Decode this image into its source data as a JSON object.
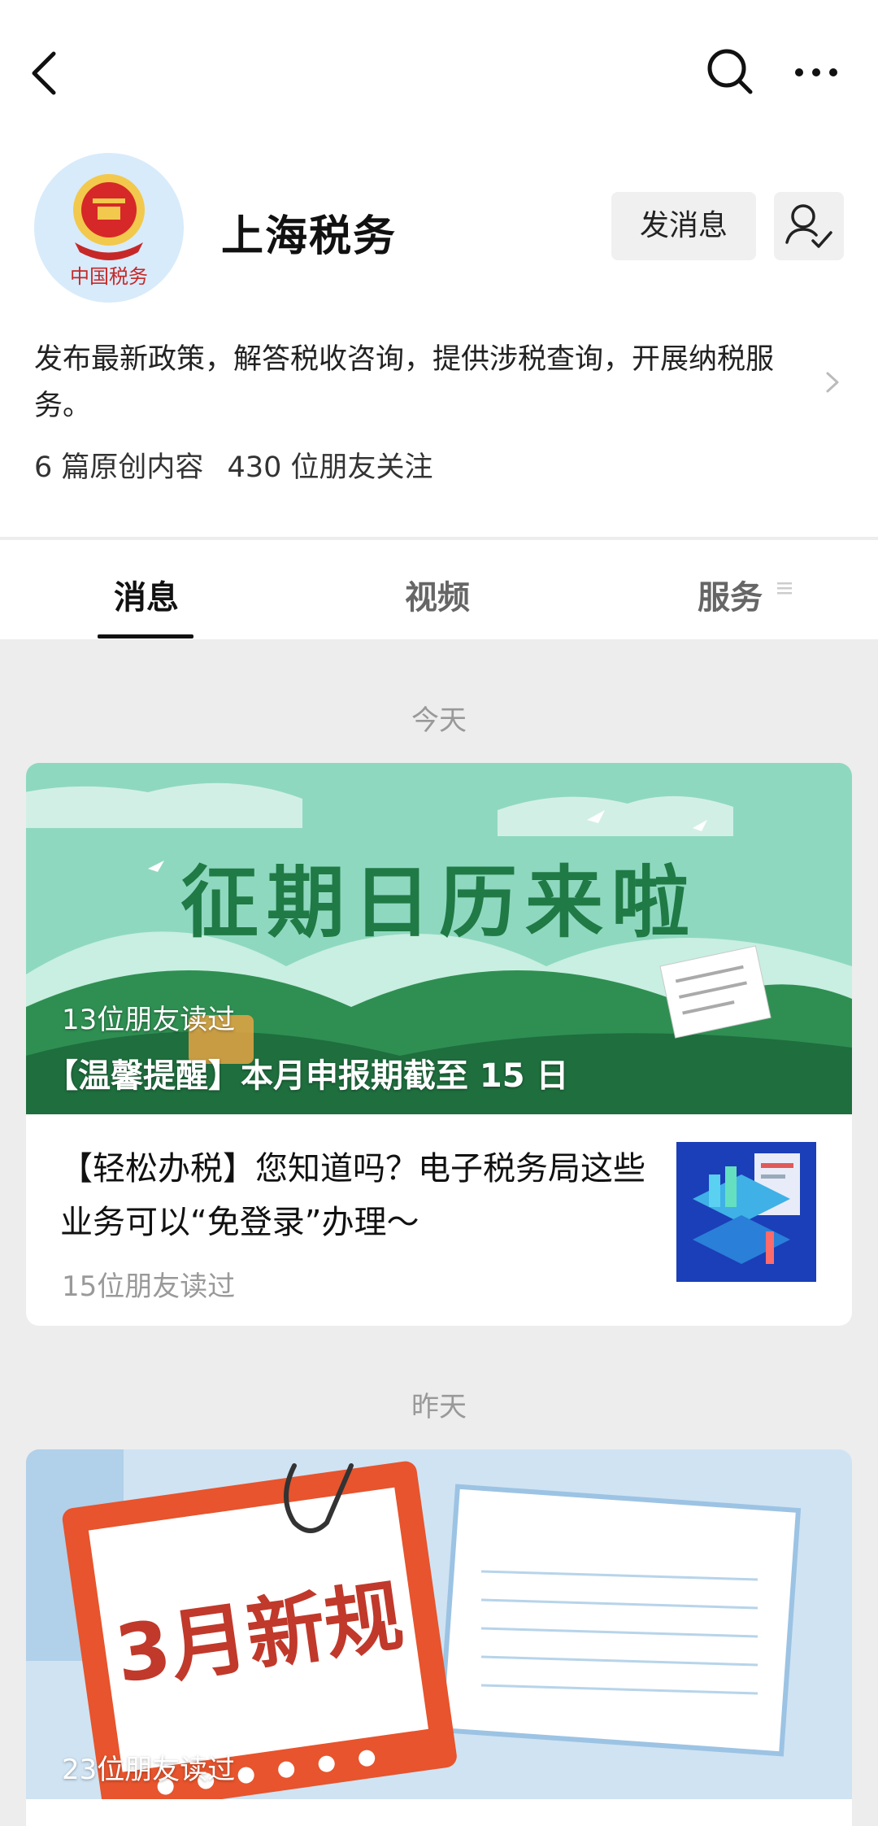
{
  "account": {
    "name": "上海税务",
    "description": "发布最新政策，解答税收咨询，提供涉税查询，开展纳税服务。",
    "stats": [
      "6 篇原创内容",
      "430 位朋友关注"
    ],
    "message_button": "发消息",
    "avatar_seal_text": "中国税务"
  },
  "tabs": [
    {
      "label": "消息",
      "active": true
    },
    {
      "label": "视频",
      "active": false
    },
    {
      "label": "服务",
      "active": false
    }
  ],
  "feed": [
    {
      "day": "今天",
      "cover": {
        "banner_text": "征期日历来啦",
        "readers": "13位朋友读过",
        "title": "【温馨提醒】本月申报期截至 15 日"
      },
      "articles": [
        {
          "title": "【轻松办税】您知道吗？电子税务局这些业务可以“免登录”办理～",
          "readers": "15位朋友读过"
        }
      ]
    },
    {
      "day": "昨天",
      "cover": {
        "banner_text": "3月新规",
        "readers": "23位朋友读过"
      }
    }
  ],
  "icons": {
    "back": "chevron-left-icon",
    "search": "search-icon",
    "more": "more-icon",
    "follow": "user-check-icon",
    "chevron": "chevron-right-icon"
  },
  "colors": {
    "banner_green": "#2f8f52",
    "tab_active": "#111111",
    "muted_text": "#999999"
  }
}
